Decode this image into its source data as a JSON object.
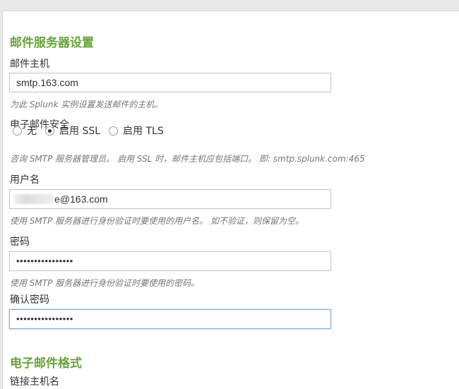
{
  "mail_server": {
    "section_title": "邮件服务器设置",
    "host": {
      "label": "邮件主机",
      "value": "smtp.163.com",
      "help": "为此 Splunk 实例设置发送邮件的主机。"
    },
    "security": {
      "label": "电子邮件安全",
      "options": [
        {
          "label": "无",
          "checked": false
        },
        {
          "label": "启用 SSL",
          "checked": true
        },
        {
          "label": "启用 TLS",
          "checked": false
        }
      ],
      "help": "咨询 SMTP 服务器管理员。 启用 SSL 时，邮件主机应包括端口。 即: smtp.splunk.com:465"
    },
    "username": {
      "label": "用户名",
      "value_visible": "e@163.com",
      "help": "使用 SMTP 服务器进行身份验证时要使用的用户名。 如不验证，则保留为空。"
    },
    "password": {
      "label": "密码",
      "value": "••••••••••••••••",
      "help": "使用 SMTP 服务器进行身份验证时要使用的密码。"
    },
    "confirm_password": {
      "label": "确认密码",
      "value": "••••••••••••••••"
    }
  },
  "email_format": {
    "section_title": "电子邮件格式",
    "link_hostname": {
      "label": "链接主机名"
    }
  }
}
